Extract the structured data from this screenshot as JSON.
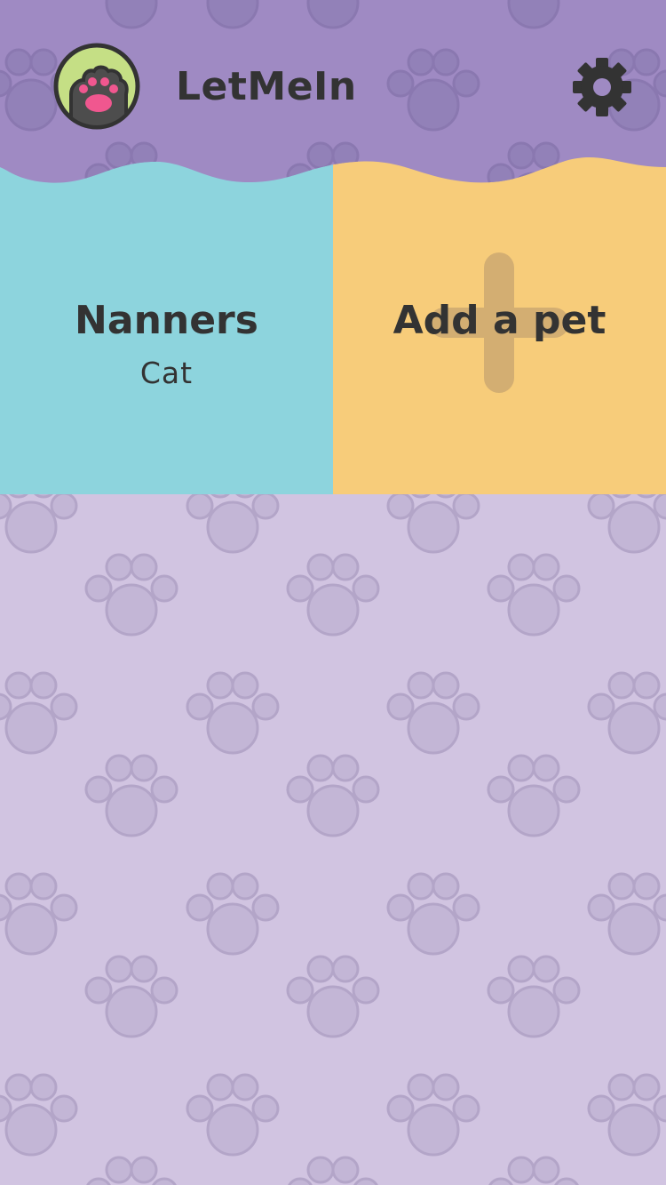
{
  "app": {
    "title": "LetMeIn"
  },
  "header": {
    "avatar_icon": "cat-paw-icon",
    "settings_icon": "gear-icon"
  },
  "pets": [
    {
      "name": "Nanners",
      "type": "Cat"
    }
  ],
  "add_tile": {
    "label": "Add a pet",
    "icon": "plus-icon"
  },
  "colors": {
    "header": "#9f8ac3",
    "background": "#d1c4e1",
    "pet_tile": "#8dd4dd",
    "add_tile": "#f7cc7a",
    "avatar_bg": "#c5df85",
    "paw_pad": "#f0578f",
    "text": "#333333"
  }
}
